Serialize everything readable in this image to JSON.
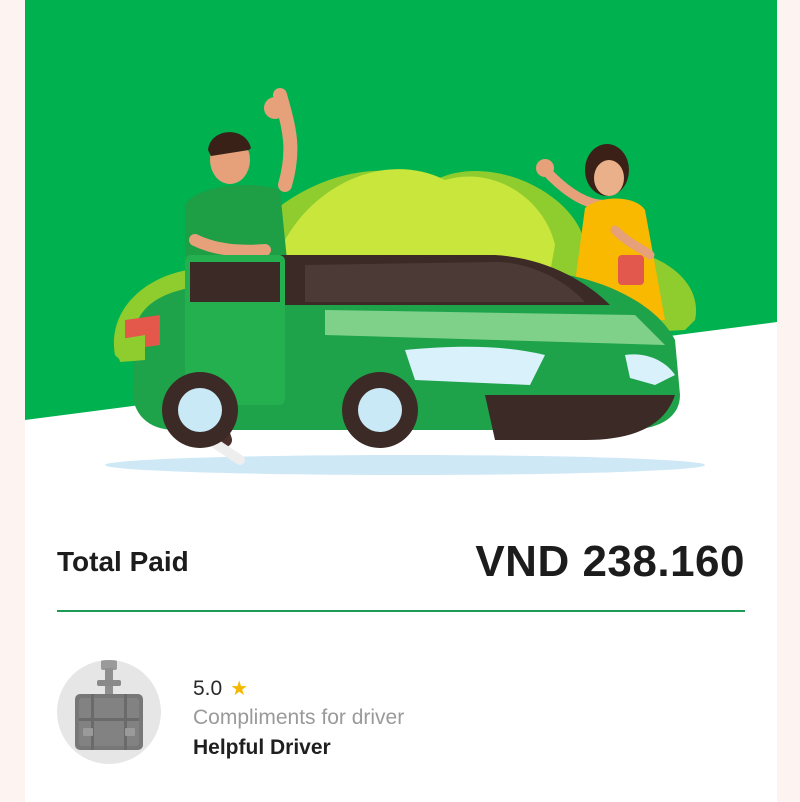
{
  "receipt": {
    "total_label": "Total Paid",
    "total_amount": "VND 238.160"
  },
  "driver": {
    "rating": "5.0",
    "rating_icon": "star-icon",
    "compliment_caption": "Compliments for driver",
    "compliment": "Helpful Driver",
    "avatar_icon": "suitcase-icon"
  },
  "colors": {
    "brand_green": "#00b14f",
    "divider_green": "#1e9b59",
    "star": "#f5b800"
  }
}
